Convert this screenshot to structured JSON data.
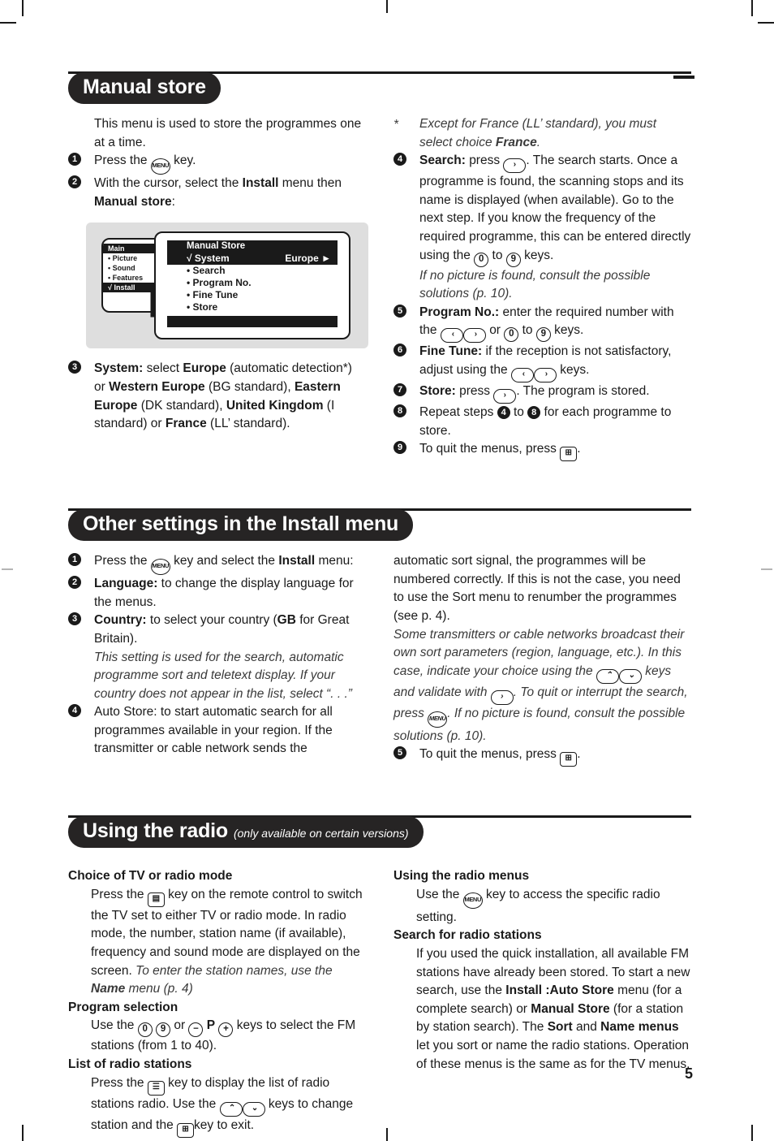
{
  "page": {
    "number": "5"
  },
  "sections": [
    {
      "id": "manual-store",
      "title": "Manual store",
      "subtitle": "",
      "left": {
        "intro": "This menu is used to store the programmes one at a time.",
        "step1_pre": "Press the",
        "step1_post": "key.",
        "step2_a": "With the cursor, select the",
        "step2_b": "Install",
        "step2_c": "menu then",
        "step2_d": "Manual store",
        "step2_e": ":",
        "step3_label": "System:",
        "step3_text": " select Europe (automatic detection*) or Western Europe (BG standard), Eastern Europe (DK standard), United Kingdom (I standard) or France (LL' standard)."
      },
      "figure": {
        "main_title": "Main",
        "main_items": [
          "• Picture",
          "• Sound",
          "• Features",
          "√ Install"
        ],
        "main_selected": "√ Install",
        "sub_title": "Manual Store",
        "sub_rows": [
          {
            "label": "√ System",
            "value": "Europe",
            "arrow": "►",
            "selected": true
          },
          {
            "label": "• Search",
            "value": "",
            "arrow": "",
            "selected": false
          },
          {
            "label": "• Program No.",
            "value": "",
            "arrow": "",
            "selected": false
          },
          {
            "label": "• Fine Tune",
            "value": "",
            "arrow": "",
            "selected": false
          },
          {
            "label": "• Store",
            "value": "",
            "arrow": "",
            "selected": false
          }
        ]
      },
      "right": {
        "footnote": "* Except for France (LL' standard), you must select choice France.",
        "step4_label": "Search:",
        "step4_a": "press",
        "step4_b": ". The search starts. Once a programme is found, the scanning stops and its name is displayed (when available). Go to the next step. If you know the frequency of the required programme, this can be entered directly using the",
        "step4_c": "to",
        "step4_d": "keys.",
        "step4_note": "If no picture is found, consult the possible solutions (p. 10).",
        "step5_label": "Program No.:",
        "step5_a": "enter the required number with the",
        "step5_b": "or",
        "step5_c": "to",
        "step5_d": "keys.",
        "step6_label": "Fine Tune:",
        "step6_a": "if the reception is not satisfactory, adjust using the",
        "step6_b": "keys.",
        "step7_label": "Store:",
        "step7_a": "press",
        "step7_b": ". The program is stored.",
        "step8_a": "Repeat steps",
        "step8_b": "to",
        "step8_c": "for each programme to store.",
        "step8_from": "4",
        "step8_to": "8",
        "step9_a": "To quit the menus, press",
        "step9_b": "."
      }
    },
    {
      "id": "other-settings",
      "title": "Other settings in the Install menu",
      "subtitle": "",
      "left": {
        "step1_a": "Press the",
        "step1_b": "key and select the",
        "step1_c": "Install",
        "step1_d": "menu:",
        "step2_label": "Language:",
        "step2_text": " to change the display language for the menus.",
        "step3_label": "Country:",
        "step3_text": " to select your country (GB for Great Britain).",
        "step3_note": "This setting is used for the search, automatic programme sort and teletext display. If your country does not appear in the list, select “. . .”",
        "step4_label": "Auto Store:",
        "step4_text": " to start automatic search for all programmes available in your region. If the transmitter or cable network sends the"
      },
      "right": {
        "cont_text": "automatic sort signal, the programmes will be numbered correctly. If this is not the case, you need to use the Sort menu to renumber the programmes (see p. 4).",
        "note_a": "Some transmitters or cable networks broadcast their own sort parameters (region, language, etc.). In this case, indicate your choice using the",
        "note_b": "keys and validate with",
        "note_c": ". To quit or interrupt the search, press",
        "note_d": ". If no picture is found, consult the possible solutions (p. 10).",
        "step5_a": "To quit the menus, press",
        "step5_b": "."
      }
    },
    {
      "id": "using-the-radio",
      "title": "Using the radio",
      "subtitle": "(only available on certain versions)",
      "left": {
        "h1": "Choice of TV or radio mode",
        "h1_a": "Press the",
        "h1_b": "key on the remote control to switch the TV set to either TV or radio mode. In radio mode, the number, station name (if available), frequency and sound mode are displayed on the screen.",
        "h1_note": "To enter the station names, use the Name menu (p. 4)",
        "h2": "Program selection",
        "h2_a": "Use the",
        "h2_b": "or",
        "h2_c": "keys to select the FM stations (from 1 to 40).",
        "h3": "List of radio stations",
        "h3_a": "Press the",
        "h3_b": "key to display the list of radio stations radio. Use the",
        "h3_c": "keys to change station and the",
        "h3_d": "key to exit."
      },
      "right": {
        "h1": "Using the radio menus",
        "h1_a": "Use the",
        "h1_b": "key to access the specific radio setting.",
        "h2": "Search for radio stations",
        "h2_text": "If you used the quick installation, all available FM stations have already been stored. To start a new search, use the Install : Auto Store menu (for a complete search) or Manual Store (for a station by station search). The Sort and Name menus let you sort or name the radio stations. Operation of these menus is the same as for the TV menus."
      }
    }
  ],
  "keys": {
    "menu": "MENU",
    "right": "›",
    "left": "‹",
    "up": "⌃",
    "down": "⌄",
    "zero": "0",
    "nine": "9",
    "minus": "−",
    "plus": "+",
    "p": "P",
    "exit": "⊞",
    "tv_radio": "▤",
    "list": "☰"
  }
}
